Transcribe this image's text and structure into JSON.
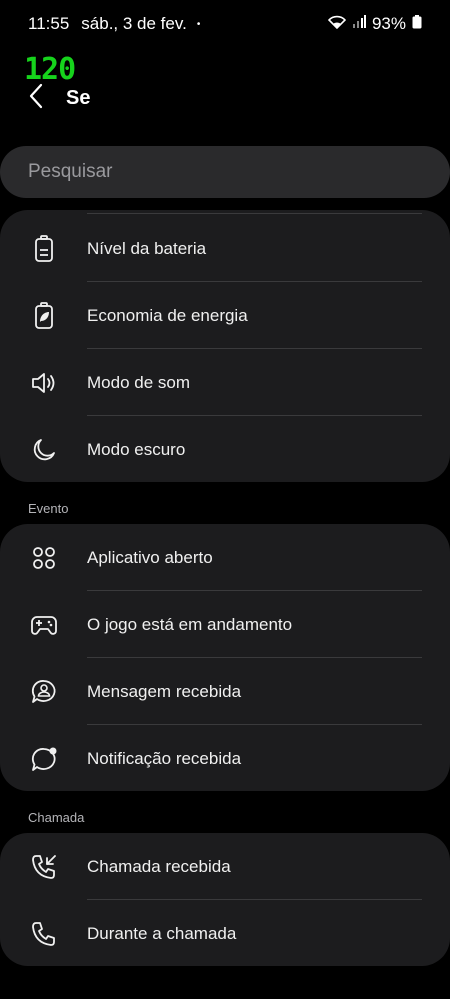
{
  "status": {
    "time": "11:55",
    "date": "sáb., 3 de fev.",
    "dot": "•",
    "battery": "93%"
  },
  "overlay": {
    "fps": "120"
  },
  "header": {
    "title": "Se"
  },
  "search": {
    "placeholder": "Pesquisar"
  },
  "groups": [
    {
      "label": "",
      "items": [
        {
          "label": "Nível da bateria",
          "icon": "battery-icon"
        },
        {
          "label": "Economia de energia",
          "icon": "battery-saver-icon"
        },
        {
          "label": "Modo de som",
          "icon": "speaker-icon"
        },
        {
          "label": "Modo escuro",
          "icon": "moon-icon"
        }
      ]
    },
    {
      "label": "Evento",
      "items": [
        {
          "label": "Aplicativo aberto",
          "icon": "apps-grid-icon"
        },
        {
          "label": "O jogo está em andamento",
          "icon": "gamepad-icon"
        },
        {
          "label": "Mensagem recebida",
          "icon": "message-person-icon"
        },
        {
          "label": "Notificação recebida",
          "icon": "notification-bubble-icon"
        }
      ]
    },
    {
      "label": "Chamada",
      "items": [
        {
          "label": "Chamada recebida",
          "icon": "incoming-call-icon"
        },
        {
          "label": "Durante a chamada",
          "icon": "phone-icon"
        }
      ]
    }
  ]
}
